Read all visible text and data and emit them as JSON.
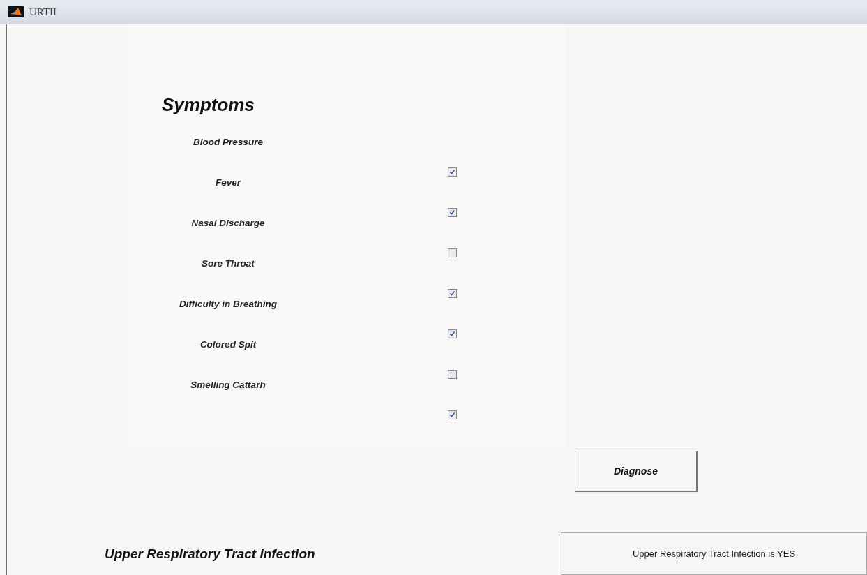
{
  "window": {
    "title": "URTII"
  },
  "heading": "Symptoms",
  "symptoms": [
    {
      "label": "Blood Pressure",
      "checked": true
    },
    {
      "label": "Fever",
      "checked": true
    },
    {
      "label": "Nasal Discharge",
      "checked": false
    },
    {
      "label": "Sore Throat",
      "checked": true
    },
    {
      "label": "Difficulty in Breathing",
      "checked": true
    },
    {
      "label": "Colored Spit",
      "checked": false
    },
    {
      "label": "Smelling Cattarh",
      "checked": true
    }
  ],
  "diagnose_button": "Diagnose",
  "result_heading": "Upper Respiratory Tract Infection",
  "result": "Upper Respiratory Tract Infection is YES"
}
